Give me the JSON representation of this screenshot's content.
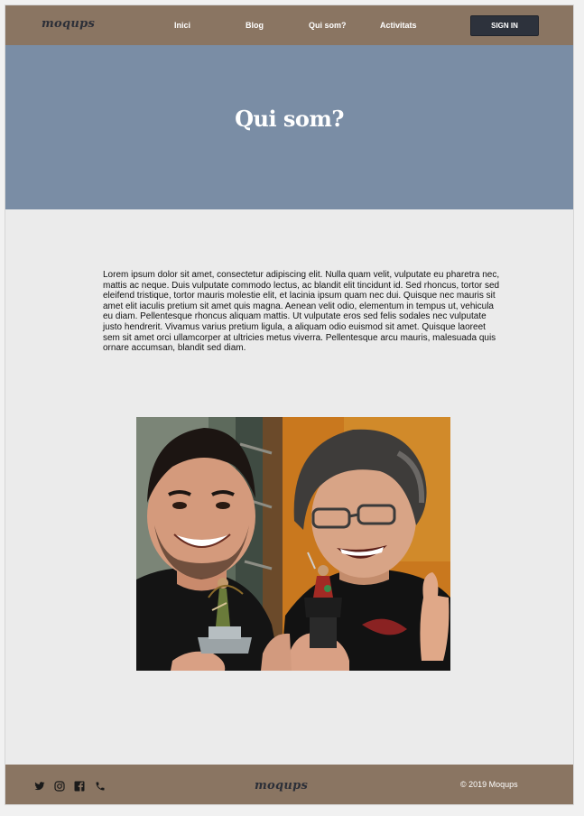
{
  "header": {
    "logo": "moqups",
    "nav": [
      {
        "label": "Inici"
      },
      {
        "label": "Blog"
      },
      {
        "label": "Qui som?"
      },
      {
        "label": "Activitats"
      }
    ],
    "signin_label": "SIGN IN"
  },
  "hero": {
    "title": "Qui som?"
  },
  "main": {
    "paragraph": "Lorem ipsum dolor sit amet, consectetur adipiscing elit. Nulla quam velit, vulputate eu pharetra nec, mattis ac neque. Duis vulputate commodo lectus, ac blandit elit tincidunt id. Sed rhoncus, tortor sed eleifend tristique, tortor mauris molestie elit, et lacinia ipsum quam nec dui. Quisque nec mauris sit amet elit iaculis pretium sit amet quis magna. Aenean velit odio, elementum in tempus ut, vehicula eu diam. Pellentesque rhoncus aliquam mattis. Ut vulputate eros sed felis sodales nec vulputate justo hendrerit. Vivamus varius pretium ligula, a aliquam odio euismod sit amet. Quisque laoreet sem sit amet orci ullamcorper at ultricies metus viverra. Pellentesque arcu mauris, malesuada quis ornare accumsan, blandit sed diam."
  },
  "footer": {
    "logo": "moqups",
    "social": [
      "twitter-icon",
      "instagram-icon",
      "facebook-icon",
      "phone-icon"
    ],
    "copyright": "© 2019  Moqups"
  },
  "colors": {
    "navbar": "#8a7562",
    "hero": "#7a8da5",
    "signin": "#2d323c",
    "page": "#ebebeb"
  }
}
